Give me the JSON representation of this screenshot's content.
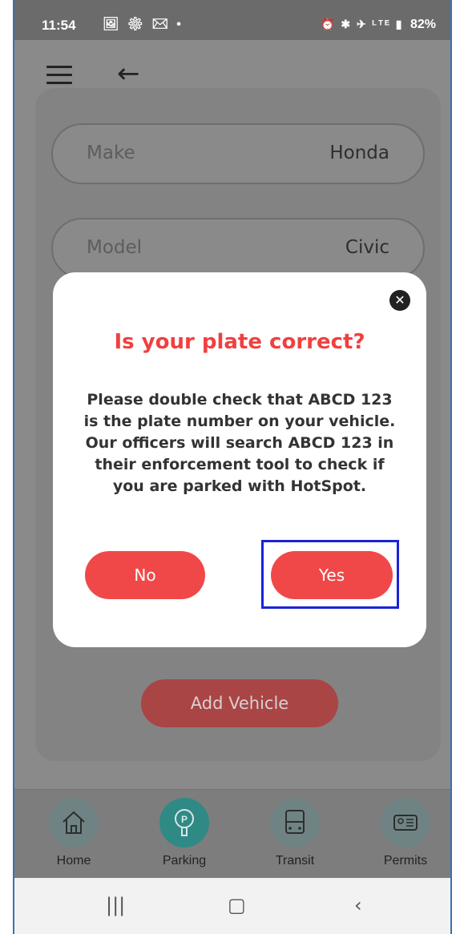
{
  "status_bar": {
    "time": "11:54",
    "notif_icons": "🖼 ⚙ ✉ •",
    "system_icons": "⏰ ✱ ✈ ᴸᵀᴱ ▮",
    "battery": "82%"
  },
  "vehicle_form": {
    "make_label": "Make",
    "make_value": "Honda",
    "model_label": "Model",
    "model_value": "Civic",
    "add_button": "Add Vehicle"
  },
  "dialog": {
    "title": "Is your plate correct?",
    "body": "Please double check that ABCD 123 is the plate number on your vehicle. Our officers will search ABCD 123 in their enforcement tool to check if you are parked with HotSpot.",
    "no_label": "No",
    "yes_label": "Yes",
    "close_glyph": "✕"
  },
  "bottom_nav": {
    "items": [
      {
        "label": "Home",
        "icon": "home-icon"
      },
      {
        "label": "Parking",
        "icon": "parking-meter-icon"
      },
      {
        "label": "Transit",
        "icon": "bus-icon"
      },
      {
        "label": "Permits",
        "icon": "id-card-icon"
      }
    ]
  },
  "colors": {
    "accent": "#f04848",
    "title": "#f04040",
    "nav_active": "#2f8a86",
    "highlight": "#1a23d8"
  }
}
